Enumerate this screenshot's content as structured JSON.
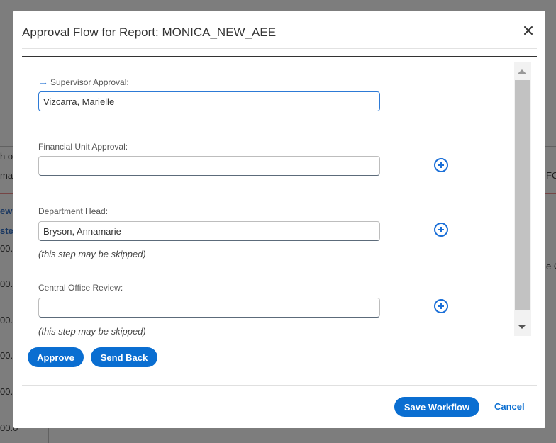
{
  "background": {
    "fragments": [
      "h o",
      "ma",
      "ew",
      "ste",
      "00.0",
      "00.0",
      "00.0",
      "00.0",
      "00.0",
      "00.0",
      "FC",
      "e C"
    ]
  },
  "dialog": {
    "title": "Approval Flow for Report: MONICA_NEW_AEE",
    "close_icon": "close-icon",
    "fields": [
      {
        "label": "Supervisor Approval:",
        "value": "Vizcarra, Marielle",
        "current": true,
        "hint": ""
      },
      {
        "label": "Financial Unit Approval:",
        "value": "",
        "current": false,
        "hint": ""
      },
      {
        "label": "Department Head:",
        "value": "Bryson, Annamarie",
        "current": false,
        "hint": "(this step may be skipped)"
      },
      {
        "label": "Central Office Review:",
        "value": "",
        "current": false,
        "hint": "(this step may be skipped)"
      }
    ],
    "buttons": {
      "approve": "Approve",
      "send_back": "Send Back",
      "save_workflow": "Save Workflow",
      "cancel": "Cancel"
    },
    "colors": {
      "primary": "#0a6ed1",
      "focus_border": "#2d7ad6"
    }
  }
}
